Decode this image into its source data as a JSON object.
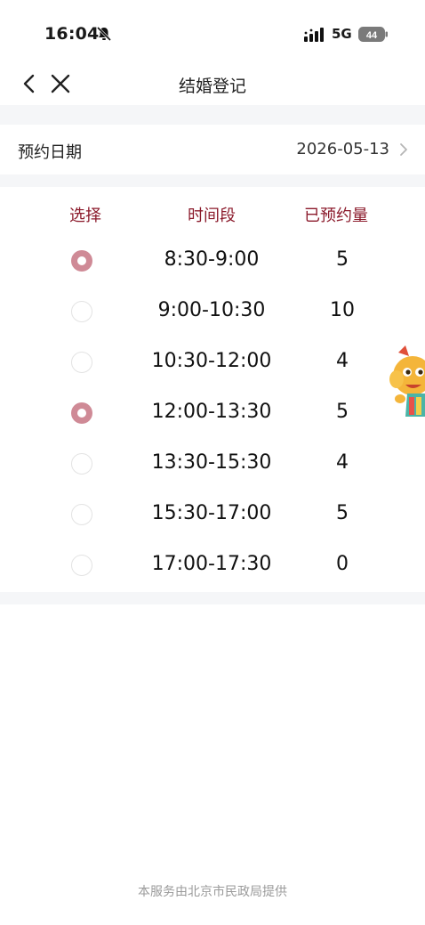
{
  "status_bar": {
    "time": "16:04",
    "network": "5G",
    "battery": "44"
  },
  "nav": {
    "title": "结婚登记"
  },
  "date_row": {
    "label": "预约日期",
    "value": "2026-05-13"
  },
  "table": {
    "headers": {
      "select": "选择",
      "time": "时间段",
      "count": "已预约量"
    },
    "rows": [
      {
        "slot": "8:30-9:00",
        "count": "5",
        "selected": true
      },
      {
        "slot": "9:00-10:30",
        "count": "10",
        "selected": false
      },
      {
        "slot": "10:30-12:00",
        "count": "4",
        "selected": false
      },
      {
        "slot": "12:00-13:30",
        "count": "5",
        "selected": true
      },
      {
        "slot": "13:30-15:30",
        "count": "4",
        "selected": false
      },
      {
        "slot": "15:30-17:00",
        "count": "5",
        "selected": false
      },
      {
        "slot": "17:00-17:30",
        "count": "0",
        "selected": false
      }
    ]
  },
  "footer": {
    "text": "本服务由北京市民政局提供"
  },
  "colors": {
    "accent": "#8b1a2b",
    "radio_selected": "#cf8a96",
    "background_gap": "#f5f6f8"
  },
  "icons": [
    "bell-muted-icon",
    "signal-icon",
    "battery-icon",
    "back-icon",
    "close-icon",
    "chevron-right-icon",
    "mascot-image"
  ]
}
